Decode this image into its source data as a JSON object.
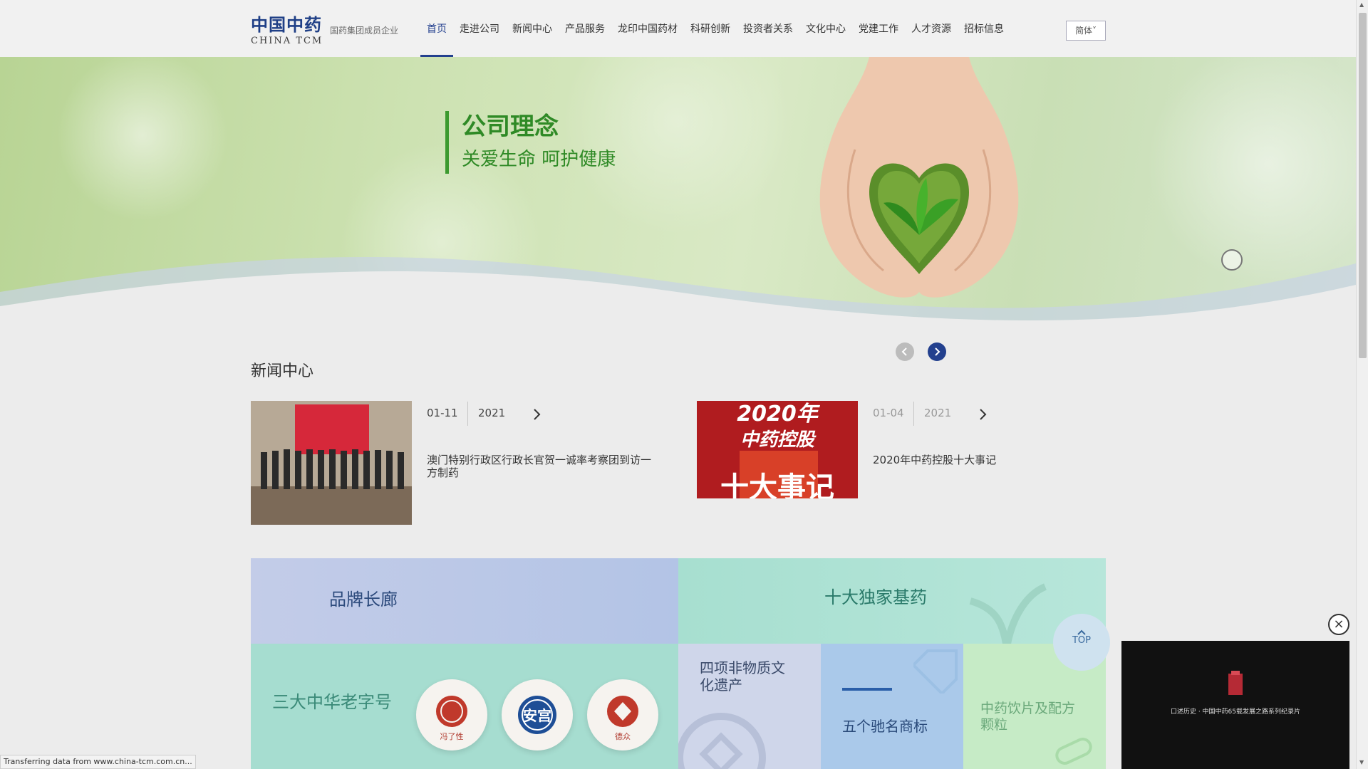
{
  "header": {
    "logo_cn": "中国中药",
    "logo_en": "CHINA TCM",
    "logo_tagline": "国药集团成员企业",
    "nav": [
      "首页",
      "走进公司",
      "新闻中心",
      "产品服务",
      "龙印中国药材",
      "科研创新",
      "投资者关系",
      "文化中心",
      "党建工作",
      "人才资源",
      "招标信息"
    ],
    "active_nav": "首页",
    "lang_button": "简体"
  },
  "banner": {
    "title": "公司理念",
    "subtitle": "关爱生命  呵护健康"
  },
  "news": {
    "section_title": "新闻中心",
    "items": [
      {
        "date": "01-11",
        "year": "2021",
        "title": "澳门特别行政区行政长官贺一诚率考察团到访一方制药"
      },
      {
        "date": "01-04",
        "year": "2021",
        "title": "2020年中药控股十大事记",
        "image_text_1": "2020年",
        "image_text_2": "中药控股",
        "image_text_3": "十大事记"
      }
    ]
  },
  "features": {
    "brand_gallery": "品牌长廊",
    "ten_medicines": "十大独家基药",
    "old_brands": "三大中华老字号",
    "heritage": "四项非物质文化遗产",
    "trademarks": "五个驰名商标",
    "decoction": "中药饮片及配方颗粒",
    "brand_names": [
      "冯了性",
      "安宫",
      "德众"
    ]
  },
  "widgets": {
    "top_button": "TOP",
    "video_caption": "口述历史 · 中国中药65载发展之路系列纪录片",
    "close": "×"
  },
  "status_bar": "Transferring data from www.china-tcm.com.cn...",
  "colors": {
    "brand_blue": "#23408e",
    "slogan_green": "#2f8a26",
    "tile_lavender": "#b9c6e6",
    "tile_mint": "#a8dfd2",
    "tile_lightgreen": "#c7ecc8"
  }
}
